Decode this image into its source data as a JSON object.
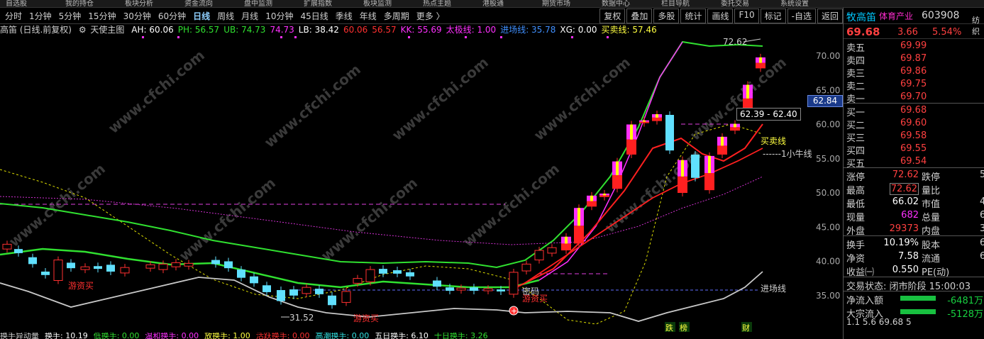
{
  "top_menu": [
    "自选股",
    "我的持仓",
    "板块分析",
    "资金流向",
    "盘中监测",
    "扩展指数",
    "板块监测",
    "热点主题",
    "港股通",
    "期货市场",
    "数据中心",
    "栏目导航",
    "委托交易",
    "系统设置"
  ],
  "periods": [
    "分时",
    "1分钟",
    "5分钟",
    "15分钟",
    "30分钟",
    "60分钟",
    "日线",
    "周线",
    "月线",
    "10分钟",
    "45日线",
    "季线",
    "年线",
    "多周期",
    "更多 〉"
  ],
  "active_period": "日线",
  "right_tools": [
    "复权",
    "叠加",
    "多股",
    "统计",
    "画线",
    "F10",
    "标记",
    "-自选",
    "返回"
  ],
  "indicator": {
    "title": "高笛 (日线.前复权)",
    "name_icon": "gear-icon",
    "name": "天使主图",
    "items": [
      {
        "text": "AH: 60.06",
        "color": "#ffffff"
      },
      {
        "text": "PH: 56.57",
        "color": "#30e030"
      },
      {
        "text": "UB: 74.73",
        "color": "#30e030"
      },
      {
        "text": "74.73",
        "color": "#ff30ff"
      },
      {
        "text": "LB: 38.42",
        "color": "#ffffff"
      },
      {
        "text": "60.06",
        "color": "#ff3030"
      },
      {
        "text": "56.57",
        "color": "#ff3030"
      },
      {
        "text": "KK: 55.69",
        "color": "#ff30ff"
      },
      {
        "text": "太极线: 1.00",
        "color": "#ff30ff"
      },
      {
        "text": "进场线: 35.78",
        "color": "#4090ff"
      },
      {
        "text": "XG: 0.00",
        "color": "#ffffff"
      },
      {
        "text": "买卖线: 57.46",
        "color": "#ffff40"
      }
    ]
  },
  "chart_data": {
    "type": "candlestick",
    "y_ticks": [
      70.0,
      65.0,
      60.0,
      55.0,
      50.0,
      45.0,
      40.0,
      35.0
    ],
    "current_price_tag": "62.84",
    "range_label": "62.39 - 62.40",
    "high_label": "72.62",
    "low_label": "31.52",
    "line_labels": {
      "buy_sell": "买卖线",
      "small_bull": "小牛线",
      "entry": "进场线"
    },
    "signal_labels": {
      "buy1": "游资买",
      "buy2": "游资买",
      "buy3": "游资买",
      "signal": "密码"
    },
    "event_badges": [
      "跌",
      "榜",
      "财"
    ],
    "watermark": "www.cfchi.com"
  },
  "bottom_strip": [
    {
      "text": "换手异动量",
      "color": "#d0d0d0"
    },
    {
      "text": "换手: 10.19",
      "color": "#ffffff"
    },
    {
      "text": "低换手: 0.00",
      "color": "#30e030"
    },
    {
      "text": "温和换手: 0.00",
      "color": "#ff30ff"
    },
    {
      "text": "放换手: 1.00",
      "color": "#ffff40"
    },
    {
      "text": "活跃换手: 0.00",
      "color": "#ff3030"
    },
    {
      "text": "高潮换手: 0.00",
      "color": "#30e0e0"
    },
    {
      "text": "五日换手: 6.10",
      "color": "#ffffff"
    },
    {
      "text": "十日换手: 3.26",
      "color": "#30e030"
    }
  ],
  "quote": {
    "name": "牧高笛",
    "sector": "体育产业",
    "code": "603908",
    "extra": "纺织",
    "price": "69.68",
    "change": "3.66",
    "pct": "5.54%"
  },
  "asks": [
    {
      "label": "卖五",
      "price": "69.99"
    },
    {
      "label": "卖四",
      "price": "69.87"
    },
    {
      "label": "卖三",
      "price": "69.86"
    },
    {
      "label": "卖二",
      "price": "69.75"
    },
    {
      "label": "卖一",
      "price": "69.70"
    }
  ],
  "bids": [
    {
      "label": "买一",
      "price": "69.68"
    },
    {
      "label": "买二",
      "price": "69.60"
    },
    {
      "label": "买三",
      "price": "69.58"
    },
    {
      "label": "买四",
      "price": "69.55"
    },
    {
      "label": "买五",
      "price": "69.54"
    }
  ],
  "stats": [
    {
      "l1": "涨停",
      "v1": "72.62",
      "c1": "#ff4040",
      "l2": "跌停",
      "v2": "5"
    },
    {
      "l1": "最高",
      "v1": "72.62",
      "c1": "#ff4040",
      "l2": "量比",
      "v2": ""
    },
    {
      "l1": "最低",
      "v1": "66.02",
      "c1": "#ffffff",
      "l2": "市值",
      "v2": "4"
    },
    {
      "l1": "现量",
      "v1": "682",
      "c1": "#ff30ff",
      "l2": "总量",
      "v2": "6"
    },
    {
      "l1": "外盘",
      "v1": "29373",
      "c1": "#ff4040",
      "l2": "内盘",
      "v2": "3"
    }
  ],
  "stats2": [
    {
      "l1": "换手",
      "v1": "10.19%",
      "c1": "#ffffff",
      "l2": "股本",
      "v2": "6"
    },
    {
      "l1": "净资",
      "v1": "7.58",
      "c1": "#ffffff",
      "l2": "流通",
      "v2": "6"
    },
    {
      "l1": "收益㈠",
      "v1": "0.550",
      "c1": "#ffffff",
      "l2": "PE(动)",
      "v2": ""
    }
  ],
  "trade_status": "交易状态: 闭市阶段 15:00:03",
  "flows": [
    {
      "label": "净流入额",
      "value": "-6481万"
    },
    {
      "label": "大宗流入",
      "value": "-5128万"
    }
  ],
  "footer_row": "1.1 5.6   69.68   5"
}
